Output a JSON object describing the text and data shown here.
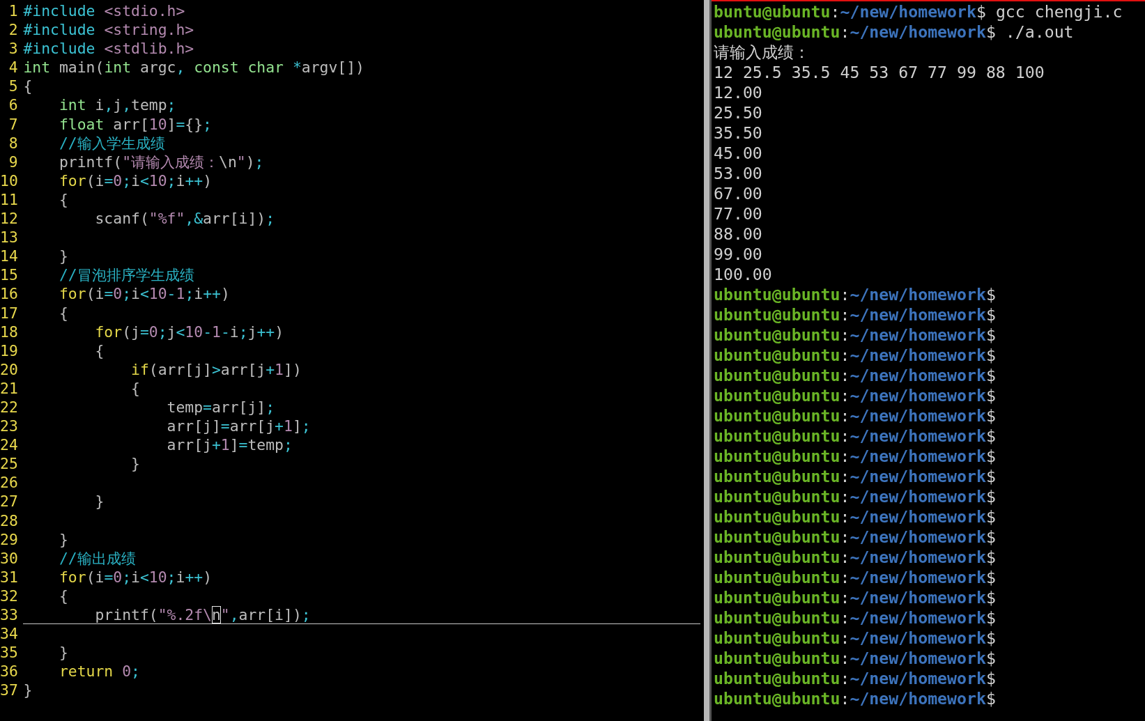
{
  "editor": {
    "lines": [
      {
        "number": "1",
        "current": false,
        "tokens": [
          {
            "kind": "pre",
            "text": "#include"
          },
          {
            "kind": "str",
            "text": " <stdio.h>"
          }
        ]
      },
      {
        "number": "2",
        "current": false,
        "tokens": [
          {
            "kind": "pre",
            "text": "#include"
          },
          {
            "kind": "str",
            "text": " <string.h>"
          }
        ]
      },
      {
        "number": "3",
        "current": false,
        "tokens": [
          {
            "kind": "pre",
            "text": "#include"
          },
          {
            "kind": "str",
            "text": " <stdlib.h>"
          }
        ]
      },
      {
        "number": "4",
        "current": false,
        "tokens": [
          {
            "kind": "type",
            "text": "int"
          },
          {
            "kind": "plain",
            "text": " main("
          },
          {
            "kind": "type",
            "text": "int"
          },
          {
            "kind": "plain",
            "text": " argc"
          },
          {
            "kind": "op",
            "text": ","
          },
          {
            "kind": "type",
            "text": " const"
          },
          {
            "kind": "type",
            "text": " char"
          },
          {
            "kind": "op",
            "text": " *"
          },
          {
            "kind": "plain",
            "text": "argv[])"
          }
        ]
      },
      {
        "number": "5",
        "current": false,
        "tokens": [
          {
            "kind": "plain",
            "text": "{"
          }
        ]
      },
      {
        "number": "6",
        "current": false,
        "tokens": [
          {
            "kind": "type",
            "text": "    int"
          },
          {
            "kind": "plain",
            "text": " i"
          },
          {
            "kind": "op",
            "text": ","
          },
          {
            "kind": "plain",
            "text": "j"
          },
          {
            "kind": "op",
            "text": ","
          },
          {
            "kind": "plain",
            "text": "temp"
          },
          {
            "kind": "op",
            "text": ";"
          }
        ]
      },
      {
        "number": "7",
        "current": false,
        "tokens": [
          {
            "kind": "type",
            "text": "    float"
          },
          {
            "kind": "plain",
            "text": " arr["
          },
          {
            "kind": "num",
            "text": "10"
          },
          {
            "kind": "plain",
            "text": "]"
          },
          {
            "kind": "op",
            "text": "="
          },
          {
            "kind": "plain",
            "text": "{}"
          },
          {
            "kind": "op",
            "text": ";"
          }
        ]
      },
      {
        "number": "8",
        "current": false,
        "tokens": [
          {
            "kind": "cmt",
            "text": "    //输入学生成绩"
          }
        ]
      },
      {
        "number": "9",
        "current": false,
        "tokens": [
          {
            "kind": "plain",
            "text": "    printf("
          },
          {
            "kind": "str",
            "text": "\"请输入成绩："
          },
          {
            "kind": "plain",
            "text": "\\n"
          },
          {
            "kind": "str",
            "text": "\""
          },
          {
            "kind": "plain",
            "text": ")"
          },
          {
            "kind": "op",
            "text": ";"
          }
        ]
      },
      {
        "number": "10",
        "current": false,
        "tokens": [
          {
            "kind": "kw",
            "text": "    for"
          },
          {
            "kind": "plain",
            "text": "(i"
          },
          {
            "kind": "op",
            "text": "="
          },
          {
            "kind": "num",
            "text": "0"
          },
          {
            "kind": "op",
            "text": ";"
          },
          {
            "kind": "plain",
            "text": "i"
          },
          {
            "kind": "op",
            "text": "<"
          },
          {
            "kind": "num",
            "text": "10"
          },
          {
            "kind": "op",
            "text": ";"
          },
          {
            "kind": "plain",
            "text": "i"
          },
          {
            "kind": "op",
            "text": "++"
          },
          {
            "kind": "plain",
            "text": ")"
          }
        ]
      },
      {
        "number": "11",
        "current": false,
        "tokens": [
          {
            "kind": "plain",
            "text": "    {"
          }
        ]
      },
      {
        "number": "12",
        "current": false,
        "tokens": [
          {
            "kind": "plain",
            "text": "        scanf("
          },
          {
            "kind": "str",
            "text": "\"%f\""
          },
          {
            "kind": "op",
            "text": ",&"
          },
          {
            "kind": "plain",
            "text": "arr[i])"
          },
          {
            "kind": "op",
            "text": ";"
          }
        ]
      },
      {
        "number": "13",
        "current": false
      },
      {
        "number": "14",
        "current": false,
        "tokens": [
          {
            "kind": "plain",
            "text": "    }"
          }
        ]
      },
      {
        "number": "15",
        "current": false,
        "tokens": [
          {
            "kind": "cmt",
            "text": "    //冒泡排序学生成绩"
          }
        ]
      },
      {
        "number": "16",
        "current": false,
        "tokens": [
          {
            "kind": "kw",
            "text": "    for"
          },
          {
            "kind": "plain",
            "text": "(i"
          },
          {
            "kind": "op",
            "text": "="
          },
          {
            "kind": "num",
            "text": "0"
          },
          {
            "kind": "op",
            "text": ";"
          },
          {
            "kind": "plain",
            "text": "i"
          },
          {
            "kind": "op",
            "text": "<"
          },
          {
            "kind": "num",
            "text": "10"
          },
          {
            "kind": "op",
            "text": "-"
          },
          {
            "kind": "num",
            "text": "1"
          },
          {
            "kind": "op",
            "text": ";"
          },
          {
            "kind": "plain",
            "text": "i"
          },
          {
            "kind": "op",
            "text": "++"
          },
          {
            "kind": "plain",
            "text": ")"
          }
        ]
      },
      {
        "number": "17",
        "current": false,
        "tokens": [
          {
            "kind": "plain",
            "text": "    {"
          }
        ]
      },
      {
        "number": "18",
        "current": false,
        "tokens": [
          {
            "kind": "kw",
            "text": "        for"
          },
          {
            "kind": "plain",
            "text": "(j"
          },
          {
            "kind": "op",
            "text": "="
          },
          {
            "kind": "num",
            "text": "0"
          },
          {
            "kind": "op",
            "text": ";"
          },
          {
            "kind": "plain",
            "text": "j"
          },
          {
            "kind": "op",
            "text": "<"
          },
          {
            "kind": "num",
            "text": "10"
          },
          {
            "kind": "op",
            "text": "-"
          },
          {
            "kind": "num",
            "text": "1"
          },
          {
            "kind": "op",
            "text": "-"
          },
          {
            "kind": "plain",
            "text": "i"
          },
          {
            "kind": "op",
            "text": ";"
          },
          {
            "kind": "plain",
            "text": "j"
          },
          {
            "kind": "op",
            "text": "++"
          },
          {
            "kind": "plain",
            "text": ")"
          }
        ]
      },
      {
        "number": "19",
        "current": false,
        "tokens": [
          {
            "kind": "plain",
            "text": "        {"
          }
        ]
      },
      {
        "number": "20",
        "current": false,
        "tokens": [
          {
            "kind": "kw",
            "text": "            if"
          },
          {
            "kind": "plain",
            "text": "(arr[j]"
          },
          {
            "kind": "op",
            "text": ">"
          },
          {
            "kind": "plain",
            "text": "arr[j"
          },
          {
            "kind": "op",
            "text": "+"
          },
          {
            "kind": "num",
            "text": "1"
          },
          {
            "kind": "plain",
            "text": "])"
          }
        ]
      },
      {
        "number": "21",
        "current": false,
        "tokens": [
          {
            "kind": "plain",
            "text": "            {"
          }
        ]
      },
      {
        "number": "22",
        "current": false,
        "tokens": [
          {
            "kind": "plain",
            "text": "                temp"
          },
          {
            "kind": "op",
            "text": "="
          },
          {
            "kind": "plain",
            "text": "arr[j]"
          },
          {
            "kind": "op",
            "text": ";"
          }
        ]
      },
      {
        "number": "23",
        "current": false,
        "tokens": [
          {
            "kind": "plain",
            "text": "                arr[j]"
          },
          {
            "kind": "op",
            "text": "="
          },
          {
            "kind": "plain",
            "text": "arr[j"
          },
          {
            "kind": "op",
            "text": "+"
          },
          {
            "kind": "num",
            "text": "1"
          },
          {
            "kind": "plain",
            "text": "]"
          },
          {
            "kind": "op",
            "text": ";"
          }
        ]
      },
      {
        "number": "24",
        "current": false,
        "tokens": [
          {
            "kind": "plain",
            "text": "                arr[j"
          },
          {
            "kind": "op",
            "text": "+"
          },
          {
            "kind": "num",
            "text": "1"
          },
          {
            "kind": "plain",
            "text": "]"
          },
          {
            "kind": "op",
            "text": "="
          },
          {
            "kind": "plain",
            "text": "temp"
          },
          {
            "kind": "op",
            "text": ";"
          }
        ]
      },
      {
        "number": "25",
        "current": false,
        "tokens": [
          {
            "kind": "plain",
            "text": "            }"
          }
        ]
      },
      {
        "number": "26",
        "current": false
      },
      {
        "number": "27",
        "current": false,
        "tokens": [
          {
            "kind": "plain",
            "text": "        }"
          }
        ]
      },
      {
        "number": "28",
        "current": false
      },
      {
        "number": "29",
        "current": false,
        "tokens": [
          {
            "kind": "plain",
            "text": "    }"
          }
        ]
      },
      {
        "number": "30",
        "current": false,
        "tokens": [
          {
            "kind": "cmt",
            "text": "    //输出成绩"
          }
        ]
      },
      {
        "number": "31",
        "current": false,
        "tokens": [
          {
            "kind": "kw",
            "text": "    for"
          },
          {
            "kind": "plain",
            "text": "(i"
          },
          {
            "kind": "op",
            "text": "="
          },
          {
            "kind": "num",
            "text": "0"
          },
          {
            "kind": "op",
            "text": ";"
          },
          {
            "kind": "plain",
            "text": "i"
          },
          {
            "kind": "op",
            "text": "<"
          },
          {
            "kind": "num",
            "text": "10"
          },
          {
            "kind": "op",
            "text": ";"
          },
          {
            "kind": "plain",
            "text": "i"
          },
          {
            "kind": "op",
            "text": "++"
          },
          {
            "kind": "plain",
            "text": ")"
          }
        ]
      },
      {
        "number": "32",
        "current": false,
        "tokens": [
          {
            "kind": "plain",
            "text": "    {"
          }
        ]
      },
      {
        "number": "33",
        "current": true,
        "tokens": [
          {
            "kind": "plain",
            "text": "        printf("
          },
          {
            "kind": "str",
            "text": "\"%.2f\\"
          },
          {
            "kind": "cursor",
            "text": "n"
          },
          {
            "kind": "str",
            "text": "\""
          },
          {
            "kind": "op",
            "text": ","
          },
          {
            "kind": "plain",
            "text": "arr[i])"
          },
          {
            "kind": "op",
            "text": ";"
          }
        ]
      },
      {
        "number": "34",
        "current": false
      },
      {
        "number": "35",
        "current": false,
        "tokens": [
          {
            "kind": "plain",
            "text": "    }"
          }
        ]
      },
      {
        "number": "36",
        "current": false,
        "tokens": [
          {
            "kind": "kw",
            "text": "    return"
          },
          {
            "kind": "num",
            "text": " 0"
          },
          {
            "kind": "op",
            "text": ";"
          }
        ]
      },
      {
        "number": "37",
        "current": false,
        "tokens": [
          {
            "kind": "plain",
            "text": "}"
          }
        ]
      }
    ]
  },
  "terminal": {
    "lines": [
      {
        "kind": "prompt",
        "user": "buntu@ubuntu",
        "separator": ":",
        "path": "~/new/homework",
        "symbol": "$",
        "command": " gcc chengji.c"
      },
      {
        "kind": "prompt",
        "user": "ubuntu@ubuntu",
        "separator": ":",
        "path": "~/new/homework",
        "symbol": "$",
        "command": " ./a.out"
      },
      {
        "kind": "output",
        "text": "请输入成绩："
      },
      {
        "kind": "output",
        "text": "12 25.5 35.5 45 53 67 77 99 88 100"
      },
      {
        "kind": "output",
        "text": "12.00"
      },
      {
        "kind": "output",
        "text": "25.50"
      },
      {
        "kind": "output",
        "text": "35.50"
      },
      {
        "kind": "output",
        "text": "45.00"
      },
      {
        "kind": "output",
        "text": "53.00"
      },
      {
        "kind": "output",
        "text": "67.00"
      },
      {
        "kind": "output",
        "text": "77.00"
      },
      {
        "kind": "output",
        "text": "88.00"
      },
      {
        "kind": "output",
        "text": "99.00"
      },
      {
        "kind": "output",
        "text": "100.00"
      },
      {
        "kind": "prompt",
        "user": "ubuntu@ubuntu",
        "separator": ":",
        "path": "~/new/homework",
        "symbol": "$"
      },
      {
        "kind": "prompt",
        "user": "ubuntu@ubuntu",
        "separator": ":",
        "path": "~/new/homework",
        "symbol": "$"
      },
      {
        "kind": "prompt",
        "user": "ubuntu@ubuntu",
        "separator": ":",
        "path": "~/new/homework",
        "symbol": "$"
      },
      {
        "kind": "prompt",
        "user": "ubuntu@ubuntu",
        "separator": ":",
        "path": "~/new/homework",
        "symbol": "$"
      },
      {
        "kind": "prompt",
        "user": "ubuntu@ubuntu",
        "separator": ":",
        "path": "~/new/homework",
        "symbol": "$"
      },
      {
        "kind": "prompt",
        "user": "ubuntu@ubuntu",
        "separator": ":",
        "path": "~/new/homework",
        "symbol": "$"
      },
      {
        "kind": "prompt",
        "user": "ubuntu@ubuntu",
        "separator": ":",
        "path": "~/new/homework",
        "symbol": "$"
      },
      {
        "kind": "prompt",
        "user": "ubuntu@ubuntu",
        "separator": ":",
        "path": "~/new/homework",
        "symbol": "$"
      },
      {
        "kind": "prompt",
        "user": "ubuntu@ubuntu",
        "separator": ":",
        "path": "~/new/homework",
        "symbol": "$"
      },
      {
        "kind": "prompt",
        "user": "ubuntu@ubuntu",
        "separator": ":",
        "path": "~/new/homework",
        "symbol": "$"
      },
      {
        "kind": "prompt",
        "user": "ubuntu@ubuntu",
        "separator": ":",
        "path": "~/new/homework",
        "symbol": "$"
      },
      {
        "kind": "prompt",
        "user": "ubuntu@ubuntu",
        "separator": ":",
        "path": "~/new/homework",
        "symbol": "$"
      },
      {
        "kind": "prompt",
        "user": "ubuntu@ubuntu",
        "separator": ":",
        "path": "~/new/homework",
        "symbol": "$"
      },
      {
        "kind": "prompt",
        "user": "ubuntu@ubuntu",
        "separator": ":",
        "path": "~/new/homework",
        "symbol": "$"
      },
      {
        "kind": "prompt",
        "user": "ubuntu@ubuntu",
        "separator": ":",
        "path": "~/new/homework",
        "symbol": "$"
      },
      {
        "kind": "prompt",
        "user": "ubuntu@ubuntu",
        "separator": ":",
        "path": "~/new/homework",
        "symbol": "$"
      },
      {
        "kind": "prompt",
        "user": "ubuntu@ubuntu",
        "separator": ":",
        "path": "~/new/homework",
        "symbol": "$"
      },
      {
        "kind": "prompt",
        "user": "ubuntu@ubuntu",
        "separator": ":",
        "path": "~/new/homework",
        "symbol": "$"
      },
      {
        "kind": "prompt",
        "user": "ubuntu@ubuntu",
        "separator": ":",
        "path": "~/new/homework",
        "symbol": "$"
      },
      {
        "kind": "prompt",
        "user": "ubuntu@ubuntu",
        "separator": ":",
        "path": "~/new/homework",
        "symbol": "$"
      },
      {
        "kind": "prompt",
        "user": "ubuntu@ubuntu",
        "separator": ":",
        "path": "~/new/homework",
        "symbol": "$"
      }
    ]
  }
}
